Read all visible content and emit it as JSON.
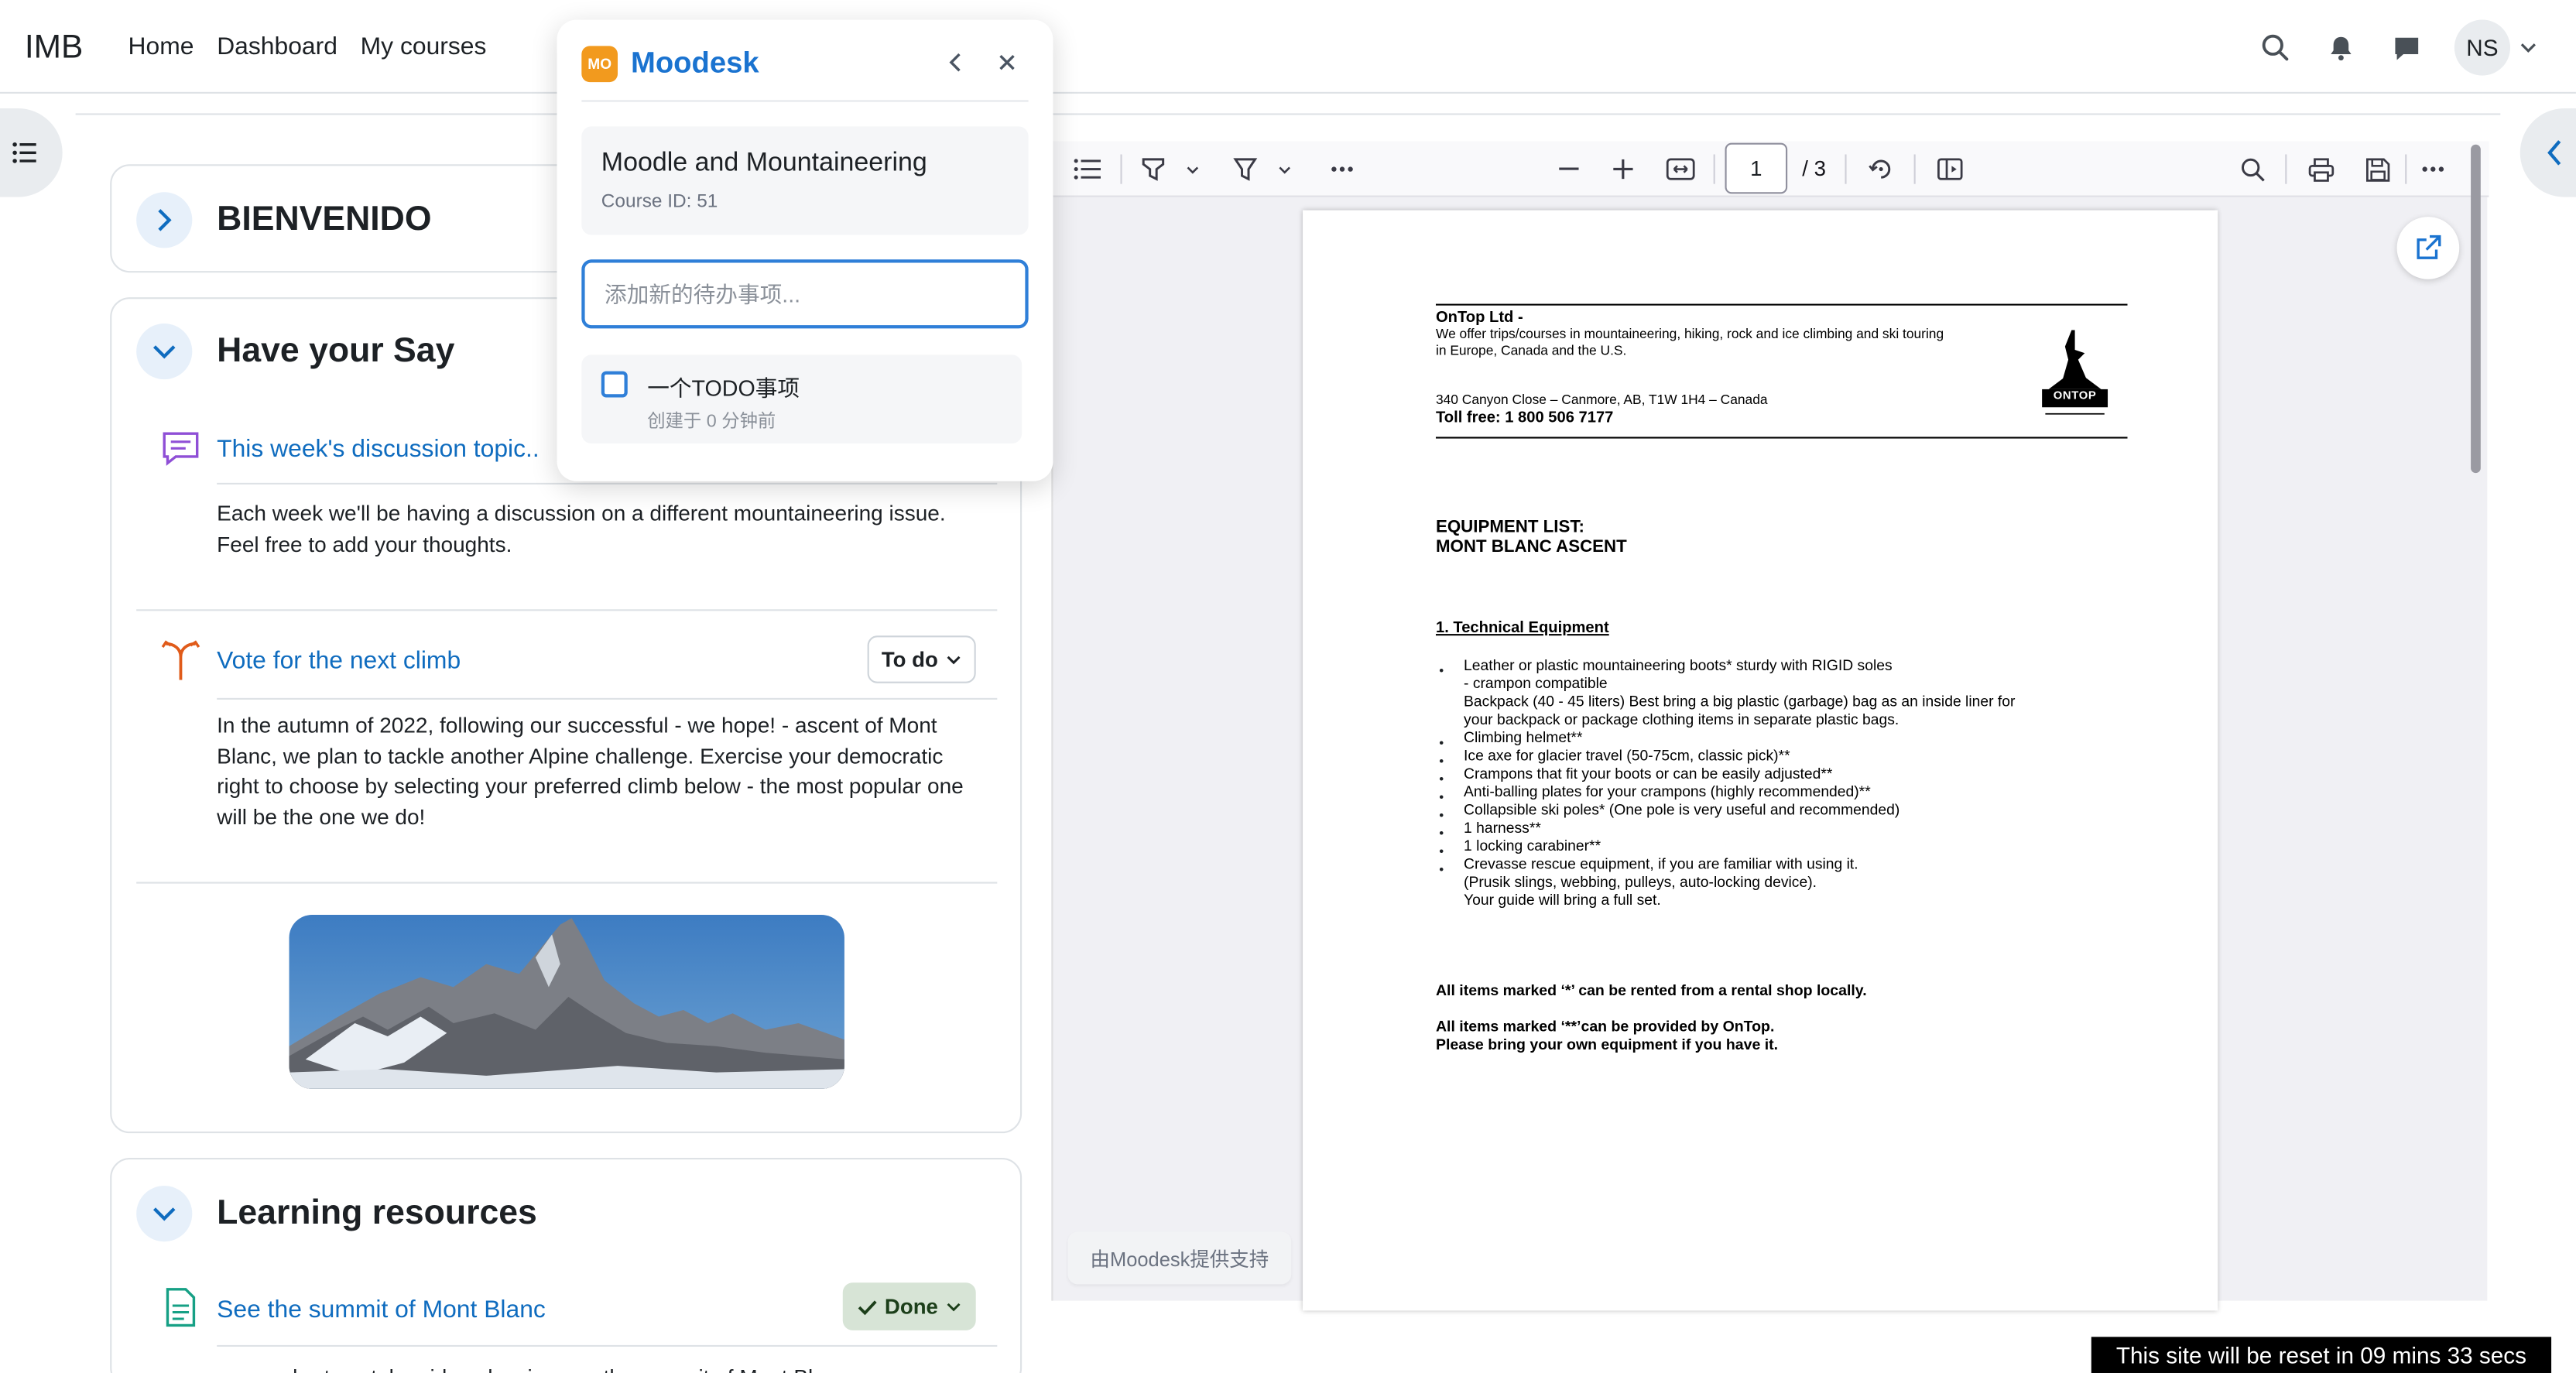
{
  "navbar": {
    "brand": "IMB",
    "links": [
      "Home",
      "Dashboard",
      "My courses"
    ],
    "user_initials": "NS"
  },
  "sections": [
    {
      "title": "BIENVENIDO"
    },
    {
      "title": "Have your Say",
      "activities": [
        {
          "name": "This week's discussion topic..",
          "description": "Each week we'll be having a discussion on a different mountaineering issue. Feel free to add your thoughts."
        },
        {
          "name": "Vote for the next climb",
          "completion": "To do",
          "description": "In the autumn of 2022, following our successful - we hope! - ascent of Mont Blanc, we plan to tackle another Alpine challenge. Exercise your democratic right to choose by selecting your preferred climb below - the most popular one will be the one we do!"
        }
      ]
    },
    {
      "title": "Learning resources",
      "activities": [
        {
          "name": "See the summit of Mont Blanc",
          "completion": "Done",
          "description": "a very short youtube video showing you the summit of Mont Blanc"
        }
      ]
    }
  ],
  "moodesk": {
    "title": "Moodesk",
    "logo_text": "MO",
    "course_name": "Moodle and Mountaineering",
    "course_id": "Course ID: 51",
    "todo_placeholder": "添加新的待办事项...",
    "todos": [
      {
        "text": "一个TODO事项",
        "created": "创建于 0 分钟前"
      }
    ],
    "powered_by": "由Moodesk提供支持"
  },
  "pdf_viewer": {
    "current_page": "1",
    "total_pages": "/ 3",
    "document": {
      "company": "OnTop Ltd -",
      "tagline_1": "We offer trips/courses in mountaineering, hiking, rock and ice climbing and ski touring",
      "tagline_2": "in Europe, Canada and the U.S.",
      "address": "340 Canyon Close – Canmore, AB, T1W 1H4 – Canada",
      "toll_free": "Toll free: 1 800 506 7177",
      "logo_text": "ONTOP",
      "heading_1": "EQUIPMENT LIST:",
      "heading_2": "MONT BLANC ASCENT",
      "section_heading": "1. Technical Equipment",
      "items": [
        "Leather or plastic mountaineering boots* sturdy with RIGID soles",
        "- crampon compatible",
        "Backpack (40 - 45 liters) Best bring a big plastic (garbage) bag as an inside liner for",
        "your backpack or package clothing items in separate plastic bags.",
        "Climbing helmet**",
        "Ice axe for glacier travel (50-75cm, classic pick)**",
        "Crampons that fit your boots or can be easily adjusted**",
        "Anti-balling plates for your crampons (highly recommended)**",
        "Collapsible ski poles* (One pole is very useful and recommended)",
        "1 harness**",
        "1 locking carabiner**",
        "Crevasse rescue equipment, if you are familiar with using it.",
        "(Prusik slings, webbing, pulleys, auto-locking device).",
        "Your guide will bring a full set."
      ],
      "note_1": "All items marked ‘*’ can be rented from a rental shop locally.",
      "note_2": "All items marked ‘**’can be provided by OnTop.",
      "note_3": "Please bring your own equipment if you have it."
    }
  },
  "reset_notice": "This site will be reset in 09 mins 33 secs",
  "colors": {
    "link": "#0f6cbf",
    "moodesk_blue": "#1a73d0",
    "moodesk_logo": "#f29a1e",
    "done_badge_bg": "#d7e4d6"
  }
}
